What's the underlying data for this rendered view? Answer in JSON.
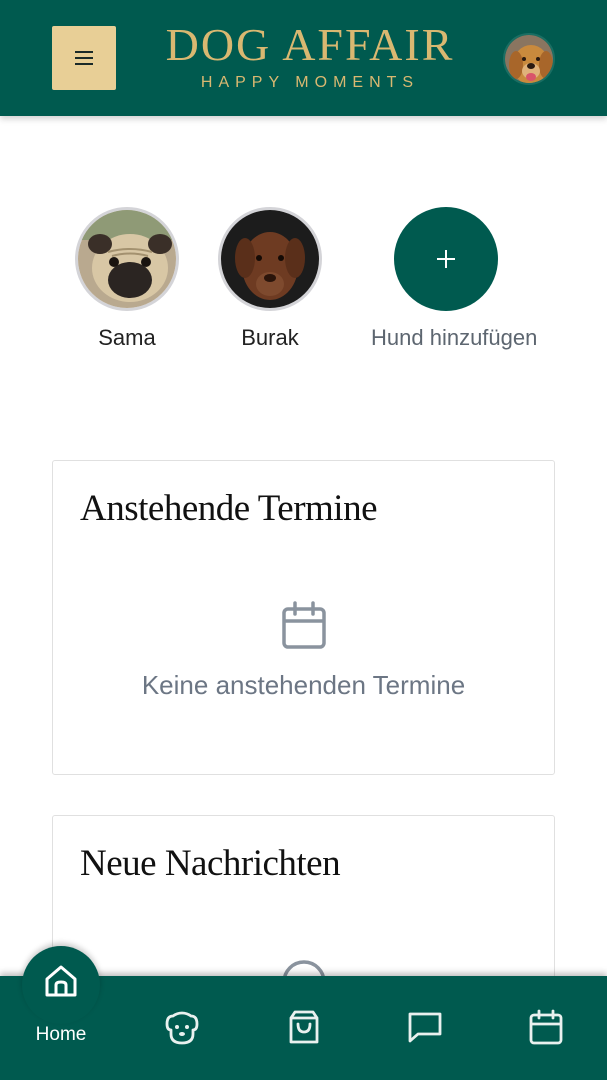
{
  "header": {
    "brand_title": "DOG AFFAIR",
    "brand_subtitle": "HAPPY MOMENTS",
    "menu_icon": "hamburger-icon",
    "avatar": "user-avatar-golden-retriever"
  },
  "dogs": [
    {
      "name": "Sama",
      "photo": "pug-photo"
    },
    {
      "name": "Burak",
      "photo": "brown-labrador-photo"
    }
  ],
  "add_dog": {
    "label": "Hund hinzufügen",
    "icon": "plus-icon"
  },
  "appointments_card": {
    "title": "Anstehende Termine",
    "empty_icon": "calendar-icon",
    "empty_text": "Keine anstehenden Termine"
  },
  "messages_card": {
    "title": "Neue Nachrichten",
    "empty_icon": "chat-icon"
  },
  "bottom_nav": {
    "items": [
      {
        "label": "Home",
        "icon": "home-icon",
        "active": true
      },
      {
        "label": "",
        "icon": "dog-face-icon",
        "active": false
      },
      {
        "label": "",
        "icon": "shopping-bag-icon",
        "active": false
      },
      {
        "label": "",
        "icon": "chat-icon",
        "active": false
      },
      {
        "label": "",
        "icon": "calendar-icon",
        "active": false
      }
    ]
  },
  "colors": {
    "primary": "#005a4f",
    "gold": "#d9b871",
    "menu_button": "#e8cf96",
    "muted_text": "#6c7684"
  }
}
